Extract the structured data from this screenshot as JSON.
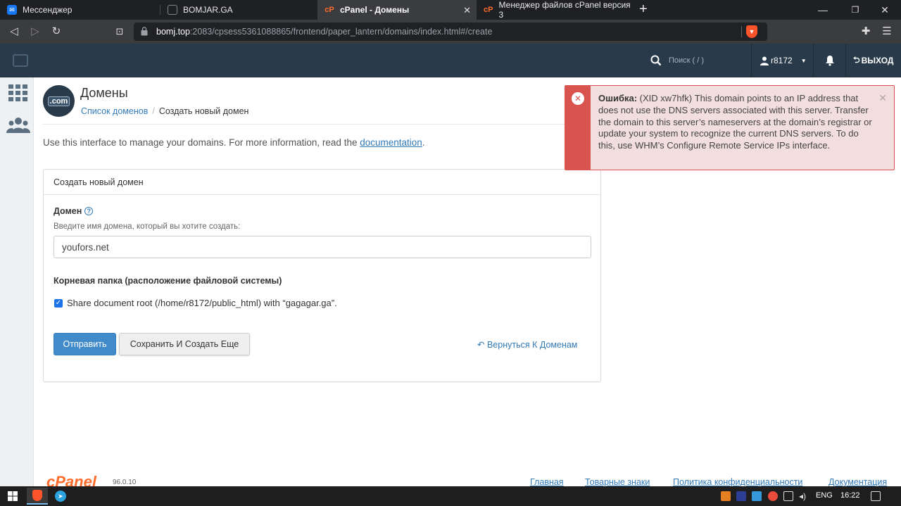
{
  "browser": {
    "tabs": [
      {
        "title": "Мессенджер",
        "active": false
      },
      {
        "title": "BOMJAR.GA",
        "active": false
      },
      {
        "title": "cPanel - Домены",
        "active": true
      },
      {
        "title": "Менеджер файлов cPanel версия 3",
        "active": false
      }
    ],
    "url_host": "bomj.top",
    "url_rest": ":2083/cpsess5361088865/frontend/paper_lantern/domains/index.html#/create"
  },
  "header": {
    "search_placeholder": "Поиск ( / )",
    "username": "r8172",
    "logout_label": "ВЫХОД"
  },
  "page": {
    "icon_label": ".com",
    "title": "Домены",
    "breadcrumb_parent": "Список доменов",
    "breadcrumb_current": "Создать новый домен",
    "intro_text": "Use this interface to manage your domains. For more information, read the ",
    "intro_link": "documentation",
    "intro_end": "."
  },
  "form": {
    "panel_title": "Создать новый домен",
    "domain_label": "Домен",
    "domain_hint": "Введите имя домена, который вы хотите создать:",
    "domain_value": "youfors.net",
    "docroot_label": "Корневая папка (расположение файловой системы)",
    "share_docroot_label": "Share document root (/home/r8172/public_html) with “gagagar.ga”.",
    "share_docroot_checked": true,
    "submit_label": "Отправить",
    "save_create_label": "Сохранить И Создать Еще",
    "back_label": "Вернуться К Доменам"
  },
  "alert": {
    "prefix": "Ошибка:",
    "message": "(XID xw7hfk) This domain points to an IP address that does not use the DNS servers associated with this server. Transfer the domain to this server’s nameservers at the domain’s registrar or update your system to recognize the current DNS servers. To do this, use WHM’s Configure Remote Service IPs interface."
  },
  "footer": {
    "logo": "cPanel",
    "version": "96.0.10",
    "links": [
      "Главная",
      "Товарные знаки",
      "Политика конфиденциальности",
      "Документация"
    ]
  },
  "taskbar": {
    "language": "ENG",
    "time": "16:22"
  },
  "colors": {
    "header_bg": "#293a4a",
    "primary_button": "#428bca",
    "link": "#337ab7",
    "alert_danger": "#d9534f",
    "alert_bg": "#f2dede",
    "cpanel_orange": "#ff6c2c"
  }
}
